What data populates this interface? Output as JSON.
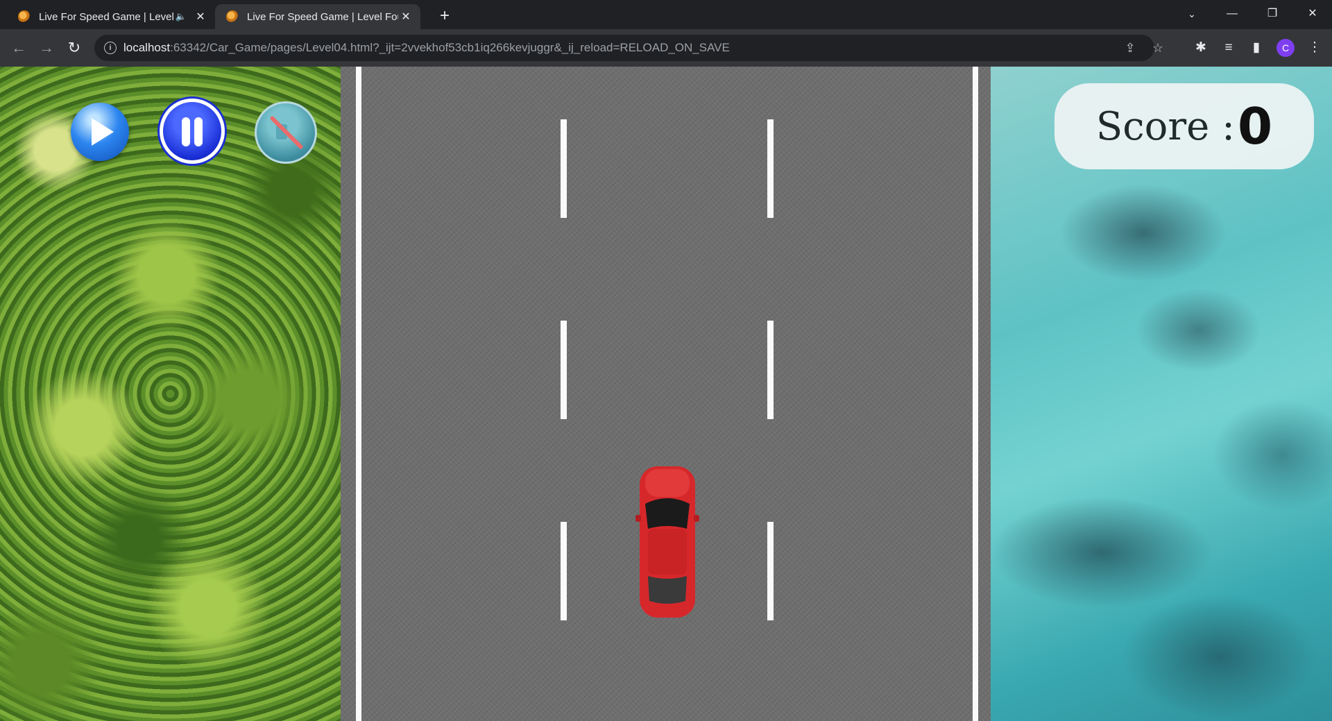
{
  "browser": {
    "tabs": [
      {
        "title": "Live For Speed Game | Level Four",
        "audio": true,
        "active": false
      },
      {
        "title": "Live For Speed Game | Level Four",
        "audio": false,
        "active": true
      }
    ],
    "url_host": "localhost",
    "url_rest": ":63342/Car_Game/pages/Level04.html?_ijt=2vvekhof53cb1iq266kevjuggr&_ij_reload=RELOAD_ON_SAVE",
    "profile_initial": "C",
    "icons": {
      "back": "←",
      "forward": "→",
      "reload": "↻",
      "new_tab": "+",
      "tab_close": "✕",
      "tab_audio": "🔈",
      "info": "i",
      "share": "⇪",
      "star": "☆",
      "extensions": "✱",
      "media": "≡",
      "sidepanel": "▮",
      "menu": "⋮",
      "tab_search": "⌄",
      "minimize": "—",
      "restore": "❐",
      "close": "✕"
    }
  },
  "game": {
    "score_label": "Score :",
    "score_value": "0",
    "controls": [
      "play",
      "pause",
      "mute"
    ],
    "player_car_color": "#d6282b"
  }
}
